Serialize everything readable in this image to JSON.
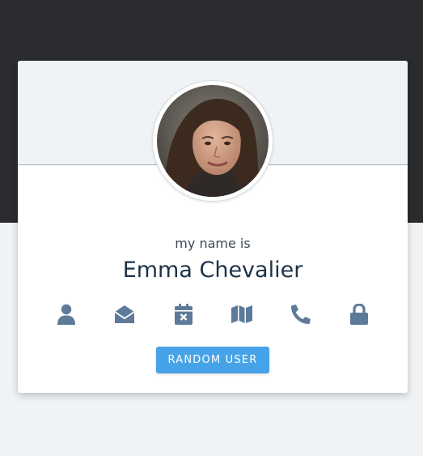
{
  "profile": {
    "subtitle": "my name is",
    "name": "Emma Chevalier"
  },
  "icons": [
    {
      "name": "user-icon",
      "label": "user"
    },
    {
      "name": "envelope-open-icon",
      "label": "email"
    },
    {
      "name": "calendar-x-icon",
      "label": "birthday"
    },
    {
      "name": "map-icon",
      "label": "location"
    },
    {
      "name": "phone-icon",
      "label": "phone"
    },
    {
      "name": "lock-icon",
      "label": "password"
    }
  ],
  "button": {
    "label": "RANDOM USER"
  },
  "colors": {
    "dark_band": "#2b2c30",
    "background": "#f0f3f6",
    "card": "#ffffff",
    "icon": "#5e7a99",
    "button": "#47a3e8",
    "name_text": "#1d3247"
  }
}
